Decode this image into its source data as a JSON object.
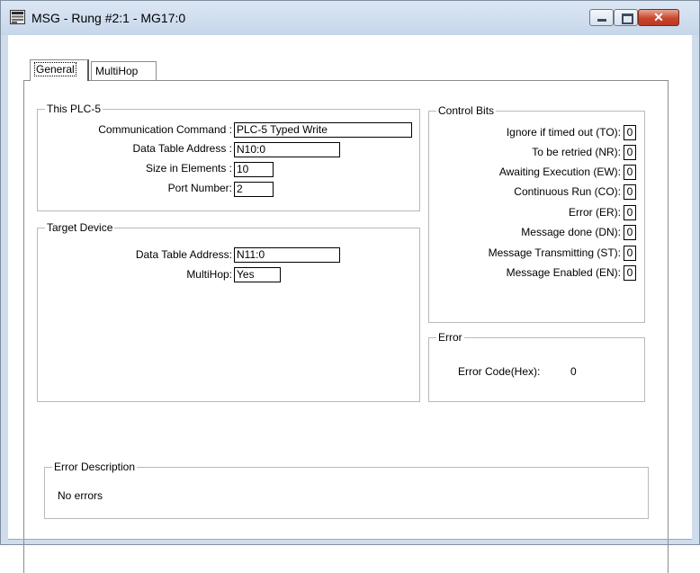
{
  "window": {
    "title": "MSG - Rung #2:1 - MG17:0"
  },
  "tabs": [
    {
      "label": "General"
    },
    {
      "label": "MultiHop"
    }
  ],
  "this_plc": {
    "group_label": "This PLC-5",
    "comm_command_label": "Communication Command :",
    "comm_command_value": "PLC-5 Typed Write",
    "data_table_address_label": "Data Table Address :",
    "data_table_address_value": "N10:0",
    "size_label": "Size in Elements :",
    "size_value": "10",
    "port_label": "Port Number:",
    "port_value": "2"
  },
  "target_device": {
    "group_label": "Target Device",
    "data_table_address_label": "Data Table Address:",
    "data_table_address_value": "N11:0",
    "multihop_label": "MultiHop:",
    "multihop_value": "Yes"
  },
  "control_bits": {
    "group_label": "Control Bits",
    "items": [
      {
        "label": "Ignore if timed out (TO):",
        "value": "0"
      },
      {
        "label": "To be retried (NR):",
        "value": "0"
      },
      {
        "label": "Awaiting Execution (EW):",
        "value": "0"
      },
      {
        "label": "Continuous Run (CO):",
        "value": "0"
      },
      {
        "label": "Error (ER):",
        "value": "0"
      },
      {
        "label": "Message done (DN):",
        "value": "0"
      },
      {
        "label": "Message Transmitting (ST):",
        "value": "0"
      },
      {
        "label": "Message Enabled (EN):",
        "value": "0"
      }
    ]
  },
  "error": {
    "group_label": "Error",
    "code_label": "Error Code(Hex):",
    "code_value": "0"
  },
  "error_description": {
    "group_label": "Error Description",
    "text": "No errors"
  },
  "colors": {
    "titlebar": "#c6d6ea",
    "close_button": "#c9462c",
    "background": "#ffffff"
  },
  "icons": {
    "app": "window-app-icon",
    "minimize": "minimize-icon",
    "maximize": "maximize-icon",
    "close": "close-icon"
  }
}
